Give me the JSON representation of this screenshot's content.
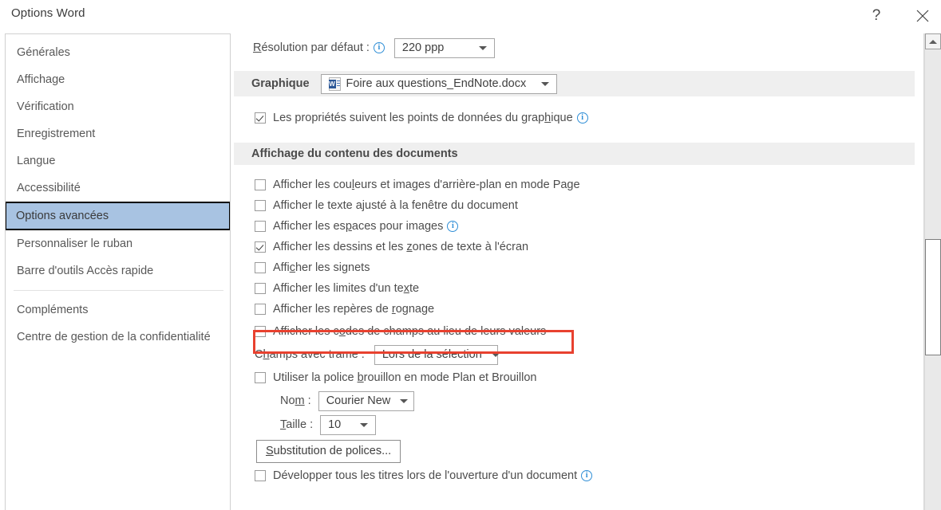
{
  "window": {
    "title": "Options Word",
    "help_label": "?",
    "help_icon": "question-mark-icon",
    "close_icon": "close-icon"
  },
  "sidebar": {
    "groups": [
      {
        "items": [
          {
            "label": "Générales",
            "selected": false
          },
          {
            "label": "Affichage",
            "selected": false
          },
          {
            "label": "Vérification",
            "selected": false
          },
          {
            "label": "Enregistrement",
            "selected": false
          },
          {
            "label": "Langue",
            "selected": false
          },
          {
            "label": "Accessibilité",
            "selected": false
          },
          {
            "label": "Options avancées",
            "selected": true
          },
          {
            "label": "Personnaliser le ruban",
            "selected": false
          },
          {
            "label": "Barre d'outils Accès rapide",
            "selected": false
          }
        ]
      },
      {
        "items": [
          {
            "label": "Compléments",
            "selected": false
          },
          {
            "label": "Centre de gestion de la confidentialité",
            "selected": false
          }
        ]
      }
    ]
  },
  "main": {
    "resolution_row": {
      "label": "Résolution par défaut :",
      "label_accesskey": "R",
      "info_icon": "info-icon",
      "combo_value": "220 ppp",
      "caret_icon": "chevron-down-icon"
    },
    "graphique_band": {
      "label": "Graphique",
      "doc_icon": "word-document-icon",
      "doc_icon_letter": "W",
      "combo_value": "Foire aux questions_EndNote.docx",
      "caret_icon": "chevron-down-icon"
    },
    "graph_checkbox": {
      "label": "Les propriétés suivent les points de données du graphique",
      "checked": true,
      "info_icon": "info-icon"
    },
    "section_title": "Affichage du contenu des documents",
    "checkboxes": [
      {
        "label": "Afficher les couleurs et images d'arrière-plan en mode Page",
        "checked": false,
        "info": false
      },
      {
        "label": "Afficher le texte ajusté à la fenêtre du document",
        "checked": false,
        "info": false
      },
      {
        "label": "Afficher les espaces pour images",
        "checked": false,
        "info": true
      },
      {
        "label": "Afficher les dessins et les zones de texte à l'écran",
        "checked": true,
        "info": false
      },
      {
        "label": "Afficher les signets",
        "checked": false,
        "info": false
      },
      {
        "label": "Afficher les limites d'un texte",
        "checked": false,
        "info": false
      },
      {
        "label": "Afficher les repères de rognage",
        "checked": false,
        "info": false
      },
      {
        "label": "Afficher les codes de champs au lieu de leurs valeurs",
        "checked": false,
        "info": false,
        "highlighted": true
      }
    ],
    "champs_row": {
      "label": "Champs avec trame :",
      "combo_value": "Lors de la sélection",
      "caret_icon": "chevron-down-icon"
    },
    "draft_font_checkbox": {
      "label": "Utiliser la police brouillon en mode Plan et Brouillon",
      "checked": false
    },
    "nom_row": {
      "label": "Nom :",
      "combo_value": "Courier New",
      "caret_icon": "chevron-down-icon"
    },
    "taille_row": {
      "label": "Taille :",
      "combo_value": "10",
      "caret_icon": "chevron-down-icon"
    },
    "substitution_button": "Substitution de polices...",
    "expand_titles_checkbox": {
      "label": "Développer tous les titres lors de l'ouverture d'un document",
      "checked": false,
      "info": true
    }
  },
  "scrollbar": {
    "up_arrow_icon": "scroll-up-arrow-icon",
    "thumb": "scrollbar-thumb"
  },
  "colors": {
    "selection_blue": "#a8c3e2",
    "band_gray": "#efefef",
    "highlight_red": "#e8412f",
    "info_blue": "#2f8ed6",
    "word_blue": "#2b5797"
  }
}
